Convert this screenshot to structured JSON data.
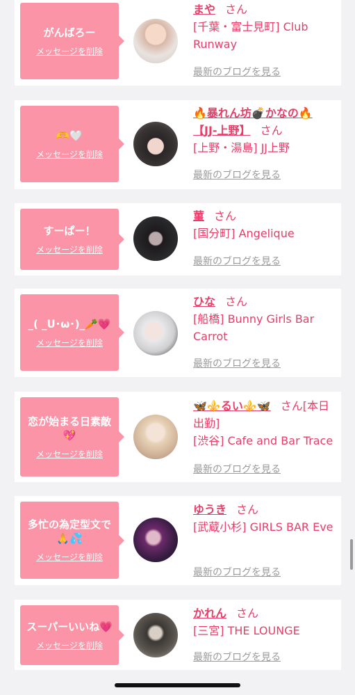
{
  "common": {
    "delete_label": "メッセージを削除",
    "blog_label": "最新のブログを見る",
    "san_label": "さん"
  },
  "items": [
    {
      "message": "がんばろー",
      "name": "まや",
      "shop": "[千葉・富士見町] Club Runway",
      "name_suffix": ""
    },
    {
      "message": "🫶🤍",
      "name": "🔥暴れん坊💣かなの🔥【JJ-上野】",
      "shop": "[上野・湯島] JJ上野",
      "name_suffix": ""
    },
    {
      "message": "すーぱー！",
      "name": "菫",
      "shop": "[国分町] Angelique",
      "name_suffix": ""
    },
    {
      "message": "_( _ᑌ･ω･)_🥕💗",
      "name": "ひな",
      "shop": "[船橋] Bunny Girls Bar Carrot",
      "name_suffix": ""
    },
    {
      "message": "恋が始まる日素敵💖",
      "name": "🦋⚜️るい⚜️🦋",
      "shop": "[渋谷] Cafe and Bar Trace",
      "name_suffix": "[本日出勤]"
    },
    {
      "message": "多忙の為定型文で🙏💦",
      "name": "ゆうき",
      "shop": "[武蔵小杉] GIRLS BAR Eve",
      "name_suffix": ""
    },
    {
      "message": "スーパーいいね💗",
      "name": "かれん",
      "shop": "[三宮] THE LOUNGE",
      "name_suffix": ""
    }
  ],
  "colors": {
    "accent": "#e83d68",
    "bubble": "#fb94a6",
    "blog_link": "#9a9a9a",
    "background": "#f2f2f4"
  }
}
